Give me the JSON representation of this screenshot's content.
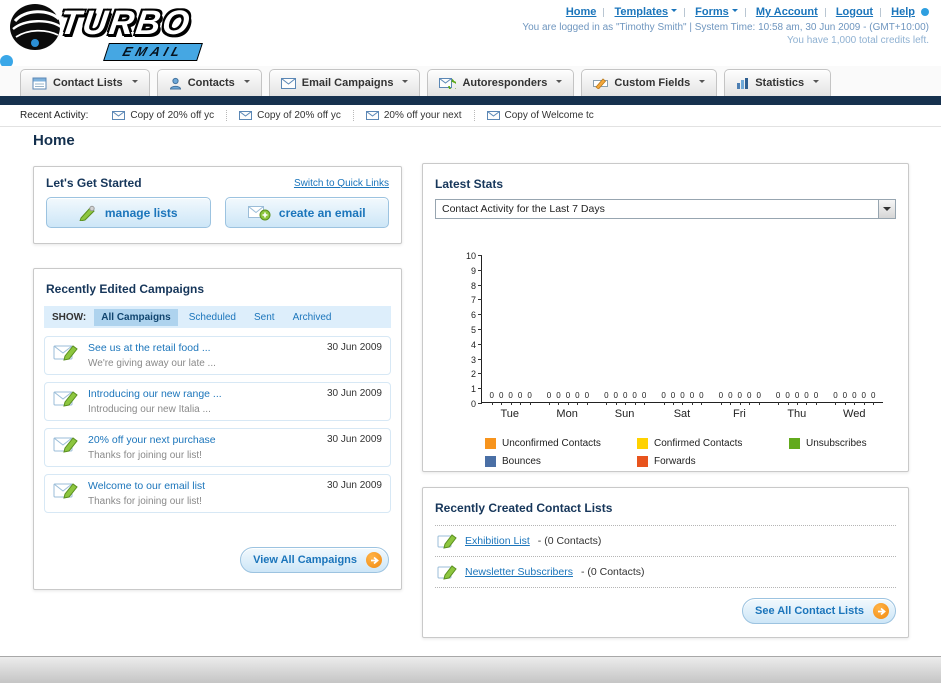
{
  "header": {
    "logo_text": "TURBO",
    "logo_sub": "EMAIL",
    "links": [
      "Home",
      "Templates",
      "Forms",
      "My Account",
      "Logout",
      "Help"
    ],
    "login_info": "You are logged in as \"Timothy Smith\" | System Time: 10:58 am, 30 Jun 2009 - (GMT+10:00)",
    "credits_info": "You have 1,000 total credits left."
  },
  "main_nav": {
    "items": [
      {
        "label": "Contact Lists"
      },
      {
        "label": "Contacts"
      },
      {
        "label": "Email Campaigns"
      },
      {
        "label": "Autoresponders"
      },
      {
        "label": "Custom Fields"
      },
      {
        "label": "Statistics"
      }
    ]
  },
  "recent_activity": {
    "label": "Recent Activity:",
    "items": [
      "Copy of 20% off yc",
      "Copy of 20% off yc",
      "20% off your next",
      "Copy of Welcome tc"
    ]
  },
  "page_title": "Home",
  "get_started": {
    "title": "Let's Get Started",
    "switch_link": "Switch to Quick Links",
    "manage_lists_label": "manage lists",
    "create_email_label": "create an email"
  },
  "campaigns": {
    "title": "Recently Edited Campaigns",
    "show_label": "SHOW:",
    "tabs": [
      "All Campaigns",
      "Scheduled",
      "Sent",
      "Archived"
    ],
    "active_tab": "All Campaigns",
    "items": [
      {
        "title": "See us at the retail food ...",
        "subtitle": "We're giving away our late ...",
        "date": "30 Jun 2009"
      },
      {
        "title": "Introducing our new range ...",
        "subtitle": "Introducing our new Italia ...",
        "date": "30 Jun 2009"
      },
      {
        "title": "20% off your next purchase",
        "subtitle": "Thanks for joining our list!",
        "date": "30 Jun 2009"
      },
      {
        "title": "Welcome to our email list",
        "subtitle": "Thanks for joining our list!",
        "date": "30 Jun 2009"
      }
    ],
    "view_all_label": "View All Campaigns"
  },
  "latest_stats": {
    "title": "Latest Stats",
    "dropdown_value": "Contact Activity for the Last 7 Days"
  },
  "chart_data": {
    "type": "bar",
    "title": "Contact Activity for the Last 7 Days",
    "categories": [
      "Tue",
      "Mon",
      "Sun",
      "Sat",
      "Fri",
      "Thu",
      "Wed"
    ],
    "series": [
      {
        "name": "Unconfirmed Contacts",
        "color": "#f7941d",
        "values": [
          0,
          0,
          0,
          0,
          0,
          0,
          0
        ]
      },
      {
        "name": "Confirmed Contacts",
        "color": "#ffd200",
        "values": [
          0,
          0,
          0,
          0,
          0,
          0,
          0
        ]
      },
      {
        "name": "Unsubscribes",
        "color": "#62aa1c",
        "values": [
          0,
          0,
          0,
          0,
          0,
          0,
          0
        ]
      },
      {
        "name": "Bounces",
        "color": "#4a6fa5",
        "values": [
          0,
          0,
          0,
          0,
          0,
          0,
          0
        ]
      },
      {
        "name": "Forwards",
        "color": "#e8541e",
        "values": [
          0,
          0,
          0,
          0,
          0,
          0,
          0
        ]
      }
    ],
    "xlabel": "",
    "ylabel": "",
    "ylim": [
      0,
      10
    ],
    "grid": false,
    "legend_position": "bottom"
  },
  "contact_lists": {
    "title": "Recently Created Contact Lists",
    "items": [
      {
        "name": "Exhibition List",
        "detail": "- (0 Contacts)"
      },
      {
        "name": "Newsletter Subscribers",
        "detail": "- (0 Contacts)"
      }
    ],
    "see_all_label": "See All Contact Lists"
  }
}
